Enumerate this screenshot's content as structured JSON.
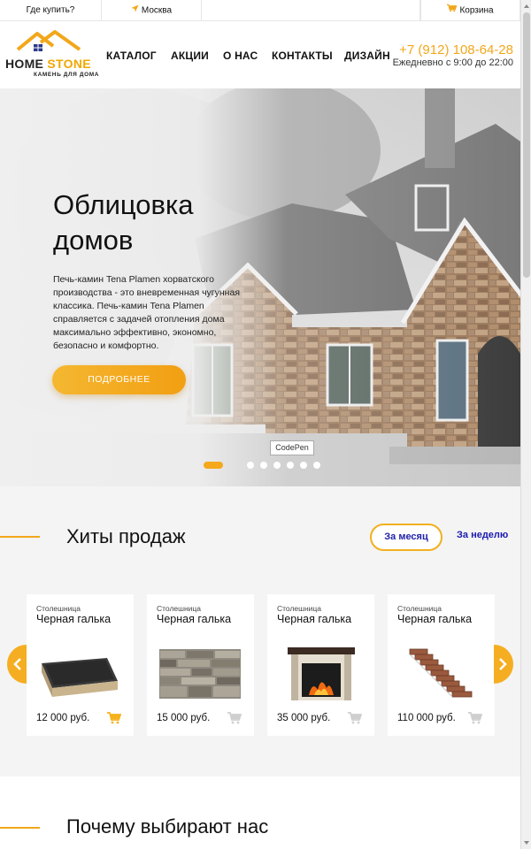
{
  "topbar": {
    "where_to_buy": "Где купить?",
    "city": "Москва",
    "cart": "Корзина"
  },
  "header": {
    "logo": {
      "word1": "HOME",
      "word2": "STONE",
      "tagline": "КАМЕНЬ ДЛЯ ДОМА"
    },
    "nav": [
      "КАТАЛОГ",
      "АКЦИИ",
      "О НАС",
      "КОНТАКТЫ",
      "ДИЗАЙН"
    ],
    "phone": "+7 (912) 108-64-28",
    "hours": "Ежедневно с 9:00 до 22:00"
  },
  "hero": {
    "title": "Облицовка домов",
    "text": "Печь-камин Tena Plamen хорватского производства - это вневременная чугунная классика. Печь-камин Tena Plamen справляется с задачей отопления дома максимально эффективно, экономно, безопасно и комфортно.",
    "button": "ПОДРОБНЕЕ",
    "tooltip": "CodePen",
    "slides": {
      "total": 8,
      "active": 1
    }
  },
  "hits": {
    "title": "Хиты продаж",
    "tabs": [
      "За месяц",
      "За неделю"
    ],
    "products": [
      {
        "category": "Столешница",
        "name": "Черная галька",
        "price": "12 000 руб.",
        "image": "countertop"
      },
      {
        "category": "Столешница",
        "name": "Черная галька",
        "price": "15 000 руб.",
        "image": "stone-panel"
      },
      {
        "category": "Столешница",
        "name": "Черная галька",
        "price": "35 000 руб.",
        "image": "fireplace"
      },
      {
        "category": "Столешница",
        "name": "Черная галька",
        "price": "110 000 руб.",
        "image": "stairs"
      }
    ]
  },
  "why": {
    "title": "Почему выбирают нас"
  },
  "colors": {
    "accent": "#f2a71b",
    "link": "#1a1ab0"
  },
  "icons": [
    "location-arrow-icon",
    "cart-icon",
    "house-roof-icon",
    "chevron-left-icon",
    "chevron-right-icon"
  ]
}
